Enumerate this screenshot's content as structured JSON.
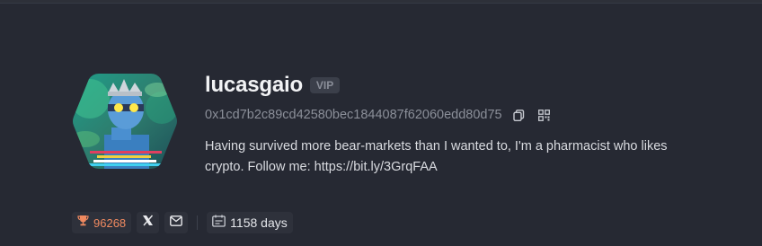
{
  "profile": {
    "username": "lucasgaio",
    "badge": "VIP",
    "address": "0x1cd7b2c89cd42580bec1844087f62060edd80d75",
    "bio": "Having survived more bear-markets than I wanted to, I'm a pharmacist who likes crypto. Follow me: https://bit.ly/3GrqFAA"
  },
  "stats": {
    "score": "96268",
    "days": "1158 days"
  },
  "icons": {
    "trophy": "trophy-icon",
    "x": "x-logo-icon",
    "mail": "mail-icon",
    "calendar": "calendar-icon",
    "copy": "copy-icon",
    "qr": "qr-code-icon"
  },
  "colors": {
    "background": "#262933",
    "score": "#f08a60",
    "muted": "#8b8f99"
  }
}
